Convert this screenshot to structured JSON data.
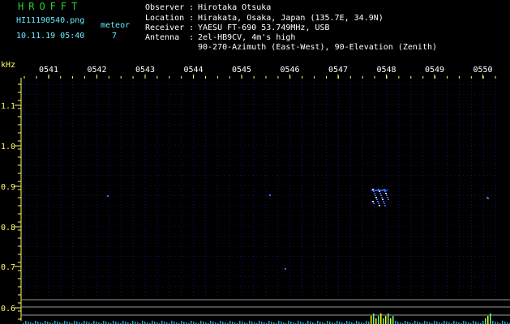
{
  "header": {
    "brand": "HROFFT",
    "filename": "HI11190540.png",
    "datetime": "10.11.19 05:40",
    "meteor_label": "meteor",
    "meteor_count": "7",
    "observer_label": "Observer :",
    "observer_value": "Hirotaka Otsuka",
    "location_label": "Location :",
    "location_value": "Hirakata, Osaka, Japan (135.7E, 34.9N)",
    "receiver_label": "Receiver :",
    "receiver_value": "YAESU FT-690 53.749MHz, USB",
    "antenna_label": "Antenna  :",
    "antenna_value1": "2el-HB9CV, 4m's high",
    "antenna_value2": "90-270-Azimuth (East-West), 90-Elevation (Zenith)"
  },
  "spectrogram": {
    "unit": "kHz",
    "time_labels": [
      "0541",
      "0542",
      "0543",
      "0544",
      "0545",
      "0546",
      "0547",
      "0548",
      "0549",
      "0550"
    ],
    "freq_labels": [
      "1.1",
      "1.0",
      "0.9",
      "0.8",
      "0.7",
      "0.6"
    ],
    "colors": {
      "grid": "#1a1aa0",
      "signal": "#3a6bff",
      "labels": "#ffff66",
      "time": "#ffffff"
    }
  }
}
